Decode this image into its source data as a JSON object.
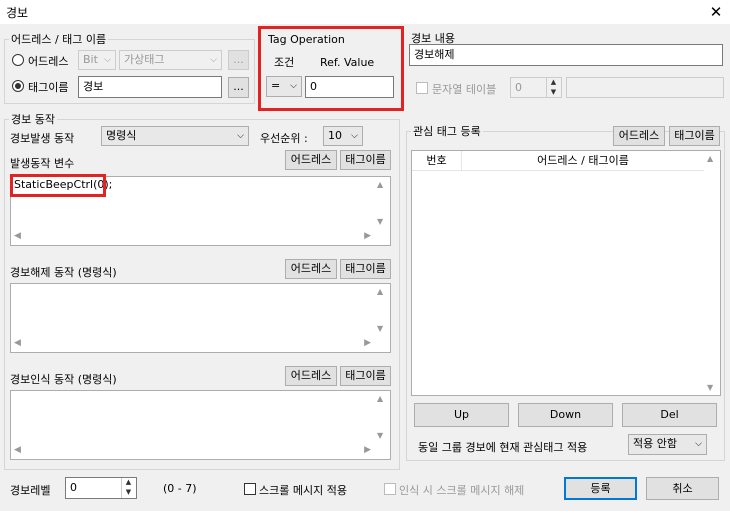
{
  "window": {
    "title": "경보",
    "close": "✕"
  },
  "address_group": {
    "legend": "어드레스 / 태그 이름",
    "address_radio": "어드레스",
    "address_type": "Bit",
    "address_value": "가상태그",
    "address_browse": "...",
    "tag_radio": "태그이름",
    "tag_value": "경보",
    "tag_browse": "..."
  },
  "tag_operation": {
    "legend": "Tag Operation",
    "condition_label": "조건",
    "ref_label": "Ref. Value",
    "condition": "=",
    "ref_value": "0"
  },
  "alarm_content": {
    "legend": "경보 내용",
    "message": "경보해제",
    "string_table_label": "문자열 테이블",
    "string_index": "0"
  },
  "alarm_action": {
    "legend": "경보 동작",
    "trigger_label": "경보발생 동작",
    "trigger_type": "명령식",
    "priority_label": "우선순위 :",
    "priority": "10",
    "var_label": "발생동작 변수",
    "address_btn": "어드레스",
    "tag_btn": "태그이름",
    "script": "StaticBeepCtrl(0);",
    "release_label": "경보해제 동작 (명령식)",
    "ack_label": "경보인식 동작 (명령식)"
  },
  "watch_tags": {
    "legend": "관심 태그 등록",
    "address_btn": "어드레스",
    "tag_btn": "태그이름",
    "col_no": "번호",
    "col_addr": "어드레스 / 태그이름",
    "up": "Up",
    "down": "Down",
    "del": "Del",
    "apply_label": "동일 그룹 경보에 현재 관심태그 적용",
    "apply_value": "적용 안함"
  },
  "footer": {
    "level_label": "경보레벨",
    "level_value": "0",
    "level_range": "(0 - 7)",
    "scroll_msg": "스크롤 메시지 적용",
    "scroll_release": "인식 시 스크롤 메시지 해제",
    "register": "등록",
    "cancel": "취소"
  }
}
